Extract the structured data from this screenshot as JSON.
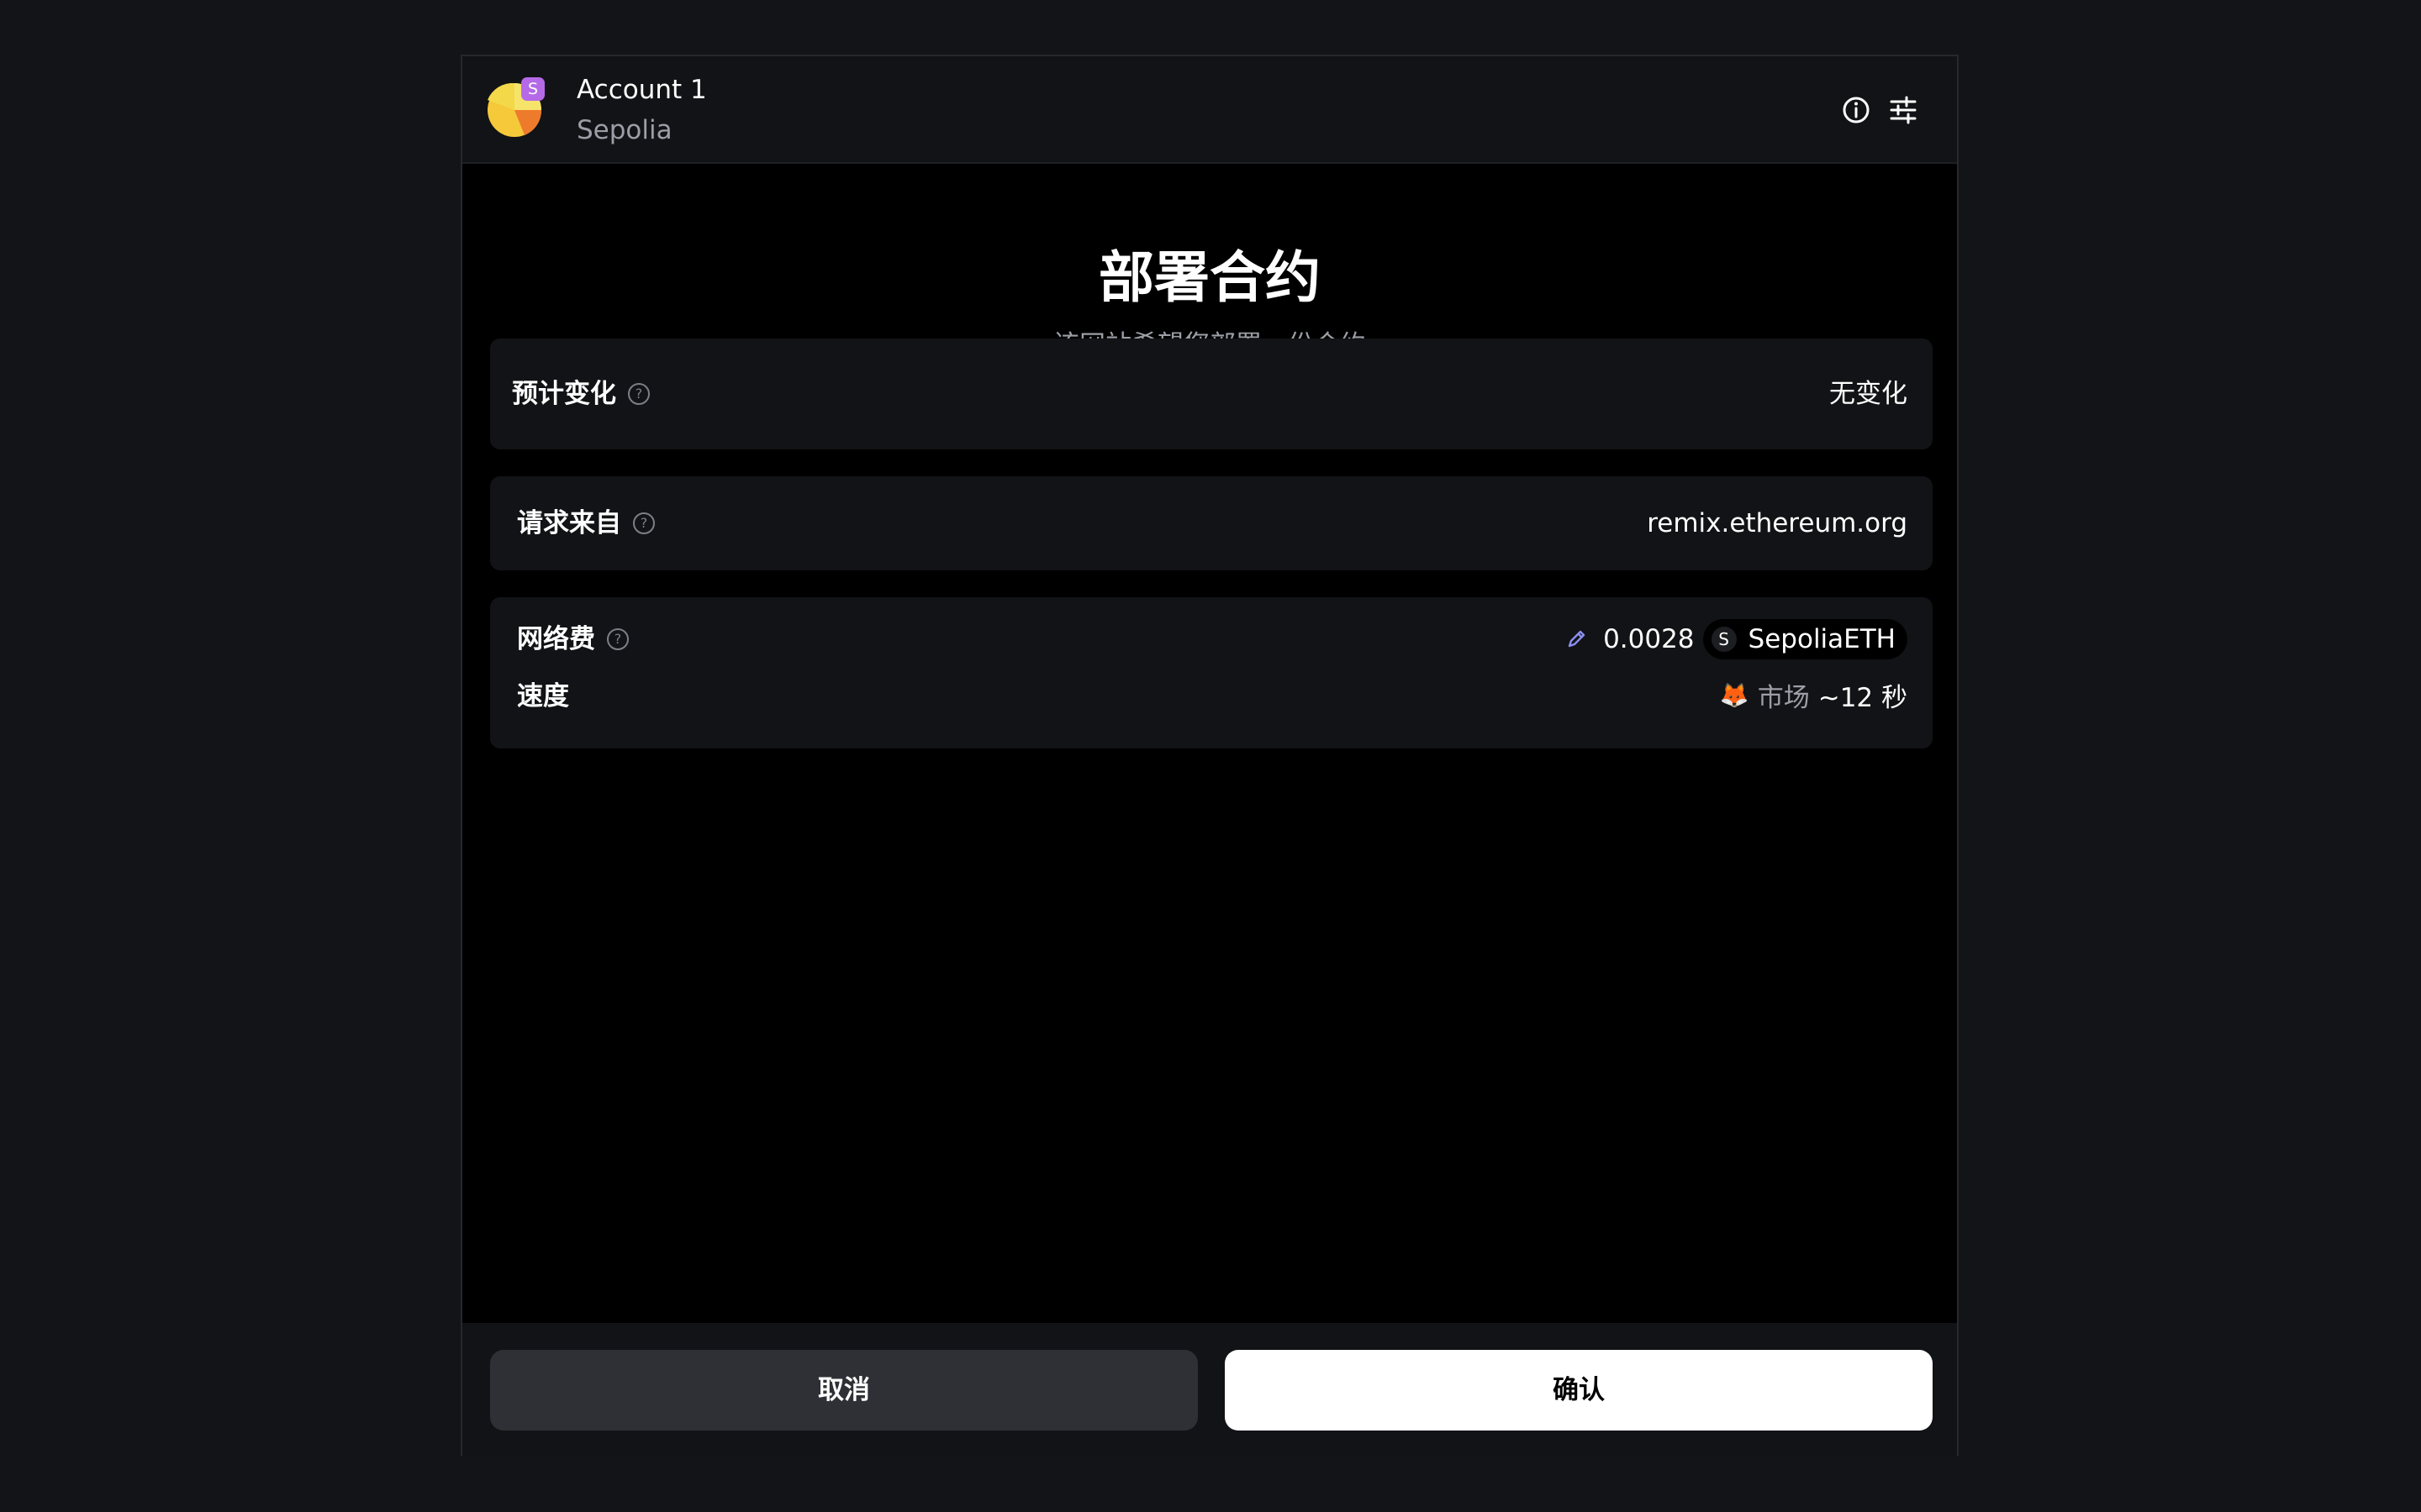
{
  "header": {
    "account_name": "Account 1",
    "network_name": "Sepolia",
    "network_badge": "S",
    "info_icon": "info-icon",
    "settings_icon": "sliders-icon"
  },
  "title": "部署合约",
  "subtitle": "该网站希望您部署一份合约",
  "estimated_changes": {
    "label": "预计变化",
    "value": "无变化"
  },
  "request_from": {
    "label": "请求来自",
    "value": "remix.ethereum.org"
  },
  "network_fee": {
    "label": "网络费",
    "amount": "0.0028",
    "token_icon": "S",
    "token": "SepoliaETH",
    "edit_icon": "pencil-icon"
  },
  "speed": {
    "label": "速度",
    "icon": "🦊",
    "mode": "市场",
    "time": "~12 秒"
  },
  "footer": {
    "cancel_label": "取消",
    "confirm_label": "确认"
  },
  "colors": {
    "page_bg": "#131417",
    "card_bg": "#121316",
    "muted_text": "#9b9ea6",
    "edit_accent": "#8b8ff0",
    "badge": "#b46ae6"
  }
}
